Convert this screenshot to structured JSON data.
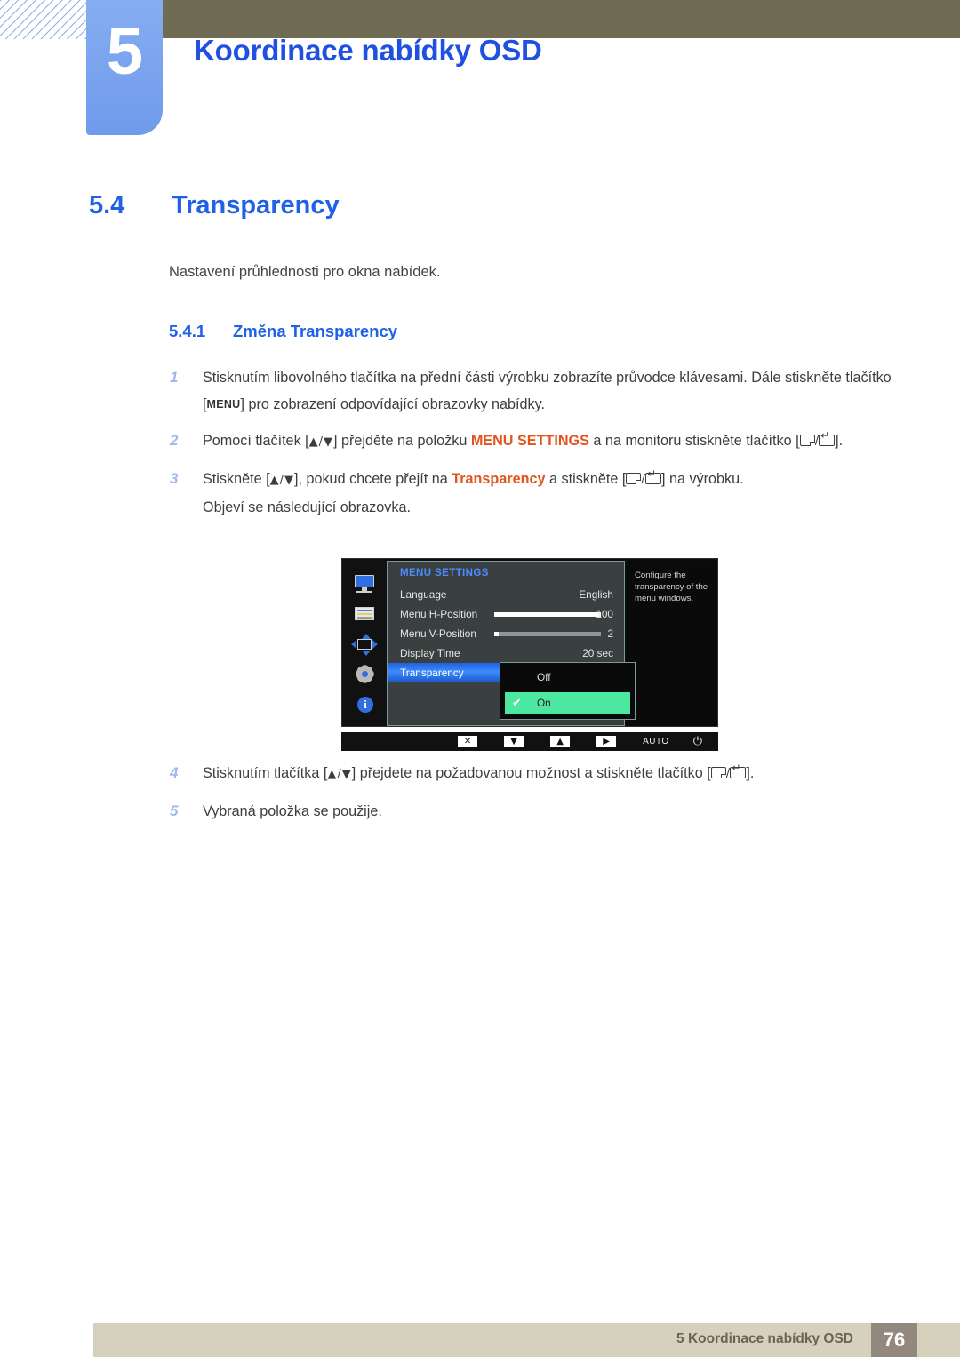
{
  "header": {
    "chapter_number": "5",
    "chapter_title": "Koordinace nabídky OSD"
  },
  "section": {
    "number": "5.4",
    "title": "Transparency",
    "intro": "Nastavení průhlednosti pro okna nabídek.",
    "sub_number": "5.4.1",
    "sub_title": "Změna Transparency"
  },
  "steps": [
    {
      "marker": "1",
      "part1": "Stisknutím libovolného tlačítka na přední části výrobku zobrazíte průvodce klávesami. Dále stiskněte tlačítko [",
      "key": "MENU",
      "part2": "] pro zobrazení odpovídající obrazovky nabídky."
    },
    {
      "marker": "2",
      "part1": "Pomocí tlačítek [",
      "arrows": "▲/▼",
      "part2": "] přejděte na položku ",
      "keyword": "MENU SETTINGS",
      "part3": " a na monitoru stiskněte tlačítko [",
      "part4": "]."
    },
    {
      "marker": "3",
      "part1": "Stiskněte [",
      "arrows": "▲/▼",
      "part2": "], pokud chcete přejít na ",
      "keyword": "Transparency",
      "part3": " a stiskněte [",
      "part4": "] na výrobku.",
      "note": "Objeví se následující obrazovka."
    },
    {
      "marker": "4",
      "part1": "Stisknutím tlačítka [",
      "arrows": "▲/▼",
      "part2": "] přejdete na požadovanou možnost a stiskněte tlačítko [",
      "part3": "]."
    },
    {
      "marker": "5",
      "part1": "Vybraná položka se použije."
    }
  ],
  "osd": {
    "title": "MENU SETTINGS",
    "sidebar_icons": [
      "monitor-icon",
      "picture-list-icon",
      "position-arrows-icon",
      "gear-icon",
      "info-icon"
    ],
    "rows": [
      {
        "label": "Language",
        "value": "English",
        "bar": null
      },
      {
        "label": "Menu H-Position",
        "value": "100",
        "bar": 100
      },
      {
        "label": "Menu V-Position",
        "value": "2",
        "bar": 4
      },
      {
        "label": "Display Time",
        "value": "20 sec",
        "bar": null
      },
      {
        "label": "Transparency",
        "value": "",
        "bar": null,
        "selected": true
      }
    ],
    "dropdown": {
      "options": [
        {
          "label": "Off",
          "checked": false
        },
        {
          "label": "On",
          "checked": true
        }
      ],
      "check_glyph": "✔"
    },
    "help_text": "Configure the transparency of the menu windows.",
    "bottom_buttons": [
      {
        "name": "close-button",
        "glyph": "✕"
      },
      {
        "name": "down-button",
        "glyph": "▼"
      },
      {
        "name": "up-button",
        "glyph": "▲"
      },
      {
        "name": "right-button",
        "glyph": "▶"
      }
    ],
    "auto_label": "AUTO",
    "power_glyph": "⏻"
  },
  "footer": {
    "text": "5 Koordinace nabídky OSD",
    "page": "76"
  },
  "colors": {
    "accent_blue": "#2061e8",
    "keyword_orange": "#e2541d",
    "topbar_olive": "#6f6c53",
    "chapter_blue": "#7aa3ee",
    "footer_beige": "#d6d1bd",
    "footer_page_box": "#93887e",
    "osd_select_green": "#4de8a0"
  }
}
